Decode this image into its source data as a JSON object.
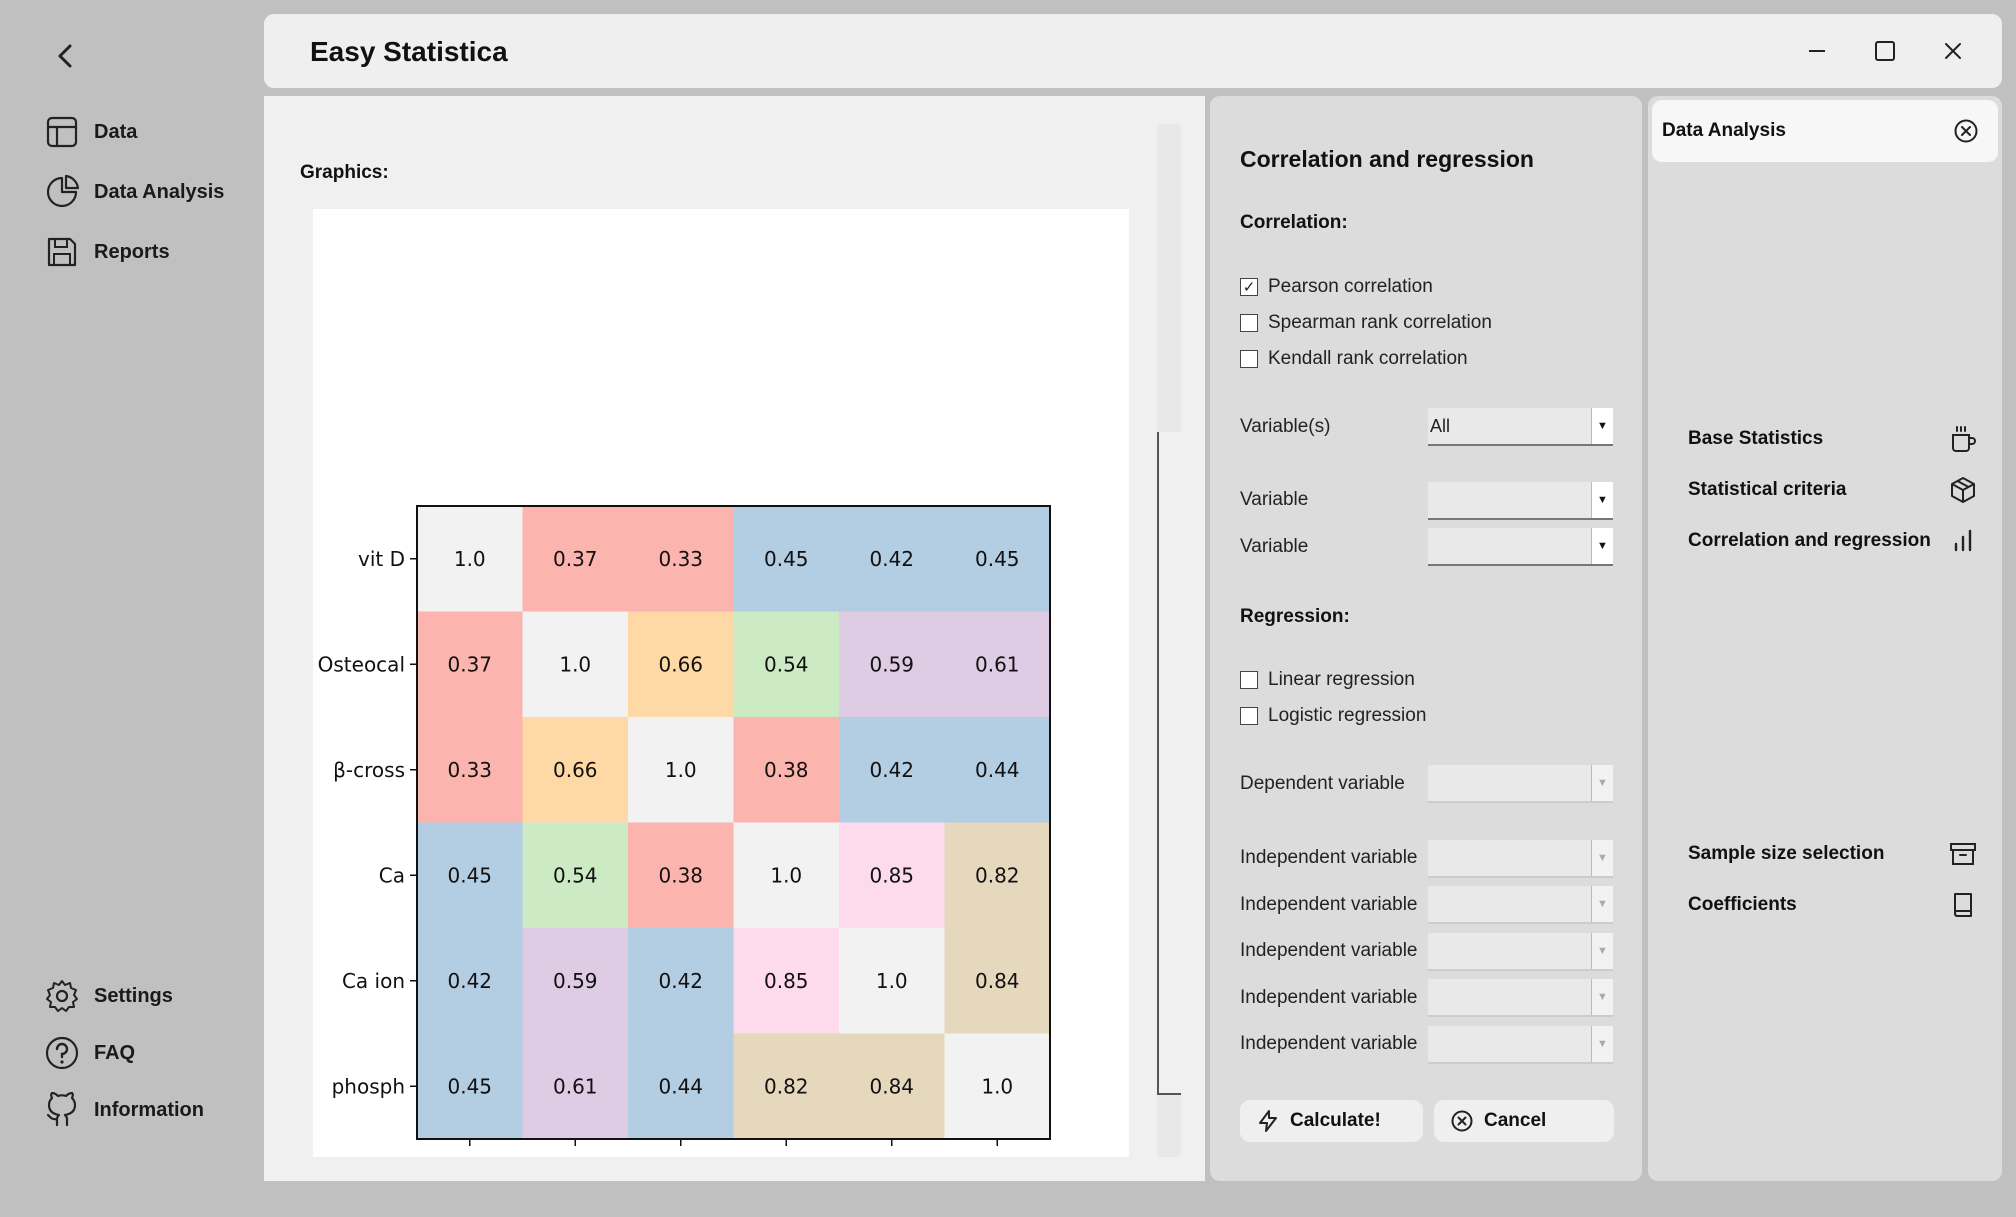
{
  "app": {
    "title": "Easy Statistica"
  },
  "sidebar": {
    "top_items": [
      {
        "label": "Data",
        "icon": "table-icon"
      },
      {
        "label": "Data Analysis",
        "icon": "pie-chart-icon"
      },
      {
        "label": "Reports",
        "icon": "save-icon"
      }
    ],
    "bottom_items": [
      {
        "label": "Settings",
        "icon": "gear-icon"
      },
      {
        "label": "FAQ",
        "icon": "help-circle-icon"
      },
      {
        "label": "Information",
        "icon": "github-icon"
      }
    ]
  },
  "main": {
    "graphics_label": "Graphics:"
  },
  "form": {
    "title": "Correlation and regression",
    "correlation_label": "Correlation:",
    "correlation_options": [
      {
        "label": "Pearson correlation",
        "checked": true
      },
      {
        "label": "Spearman rank correlation",
        "checked": false
      },
      {
        "label": "Kendall rank correlation",
        "checked": false
      }
    ],
    "variables_label": "Variable(s)",
    "variables_value": "All",
    "variable_label_1": "Variable",
    "variable_label_2": "Variable",
    "regression_label": "Regression:",
    "regression_options": [
      {
        "label": "Linear regression",
        "checked": false
      },
      {
        "label": "Logistic regression",
        "checked": false
      }
    ],
    "dependent_label": "Dependent variable",
    "independent_label": "Independent variable",
    "calculate_label": "Calculate!",
    "cancel_label": "Cancel"
  },
  "right_panel": {
    "title": "Data Analysis",
    "items": [
      {
        "label": "Base Statistics",
        "icon": "mug-icon"
      },
      {
        "label": "Statistical criteria",
        "icon": "cube-icon"
      },
      {
        "label": "Correlation and regression",
        "icon": "bar-chart-icon"
      },
      {
        "label": "Sample size selection",
        "icon": "archive-icon"
      },
      {
        "label": "Coefficients",
        "icon": "book-icon"
      }
    ]
  },
  "colors": {
    "diag": "#f2f2f2",
    "red": "#fbb4ae",
    "blue": "#b3cde3",
    "green": "#ccebc5",
    "purple": "#decbe4",
    "orange": "#fed9a6",
    "pink": "#fddaec",
    "tan": "#e5d8bd"
  },
  "chart_data": {
    "type": "heatmap",
    "labels": [
      "vit D",
      "Osteocal",
      "β-cross",
      "Ca",
      "Ca ion",
      "phosph"
    ],
    "values": [
      [
        1.0,
        0.37,
        0.33,
        0.45,
        0.42,
        0.45
      ],
      [
        0.37,
        1.0,
        0.66,
        0.54,
        0.59,
        0.61
      ],
      [
        0.33,
        0.66,
        1.0,
        0.38,
        0.42,
        0.44
      ],
      [
        0.45,
        0.54,
        0.38,
        1.0,
        0.85,
        0.82
      ],
      [
        0.42,
        0.59,
        0.42,
        0.85,
        1.0,
        0.84
      ],
      [
        0.45,
        0.61,
        0.44,
        0.82,
        0.84,
        1.0
      ]
    ],
    "cell_colors": [
      [
        "diag",
        "red",
        "red",
        "blue",
        "blue",
        "blue"
      ],
      [
        "red",
        "diag",
        "orange",
        "green",
        "purple",
        "purple"
      ],
      [
        "red",
        "orange",
        "diag",
        "red",
        "blue",
        "blue"
      ],
      [
        "blue",
        "green",
        "red",
        "diag",
        "pink",
        "tan"
      ],
      [
        "blue",
        "purple",
        "blue",
        "pink",
        "diag",
        "tan"
      ],
      [
        "blue",
        "purple",
        "blue",
        "tan",
        "tan",
        "diag"
      ]
    ]
  }
}
